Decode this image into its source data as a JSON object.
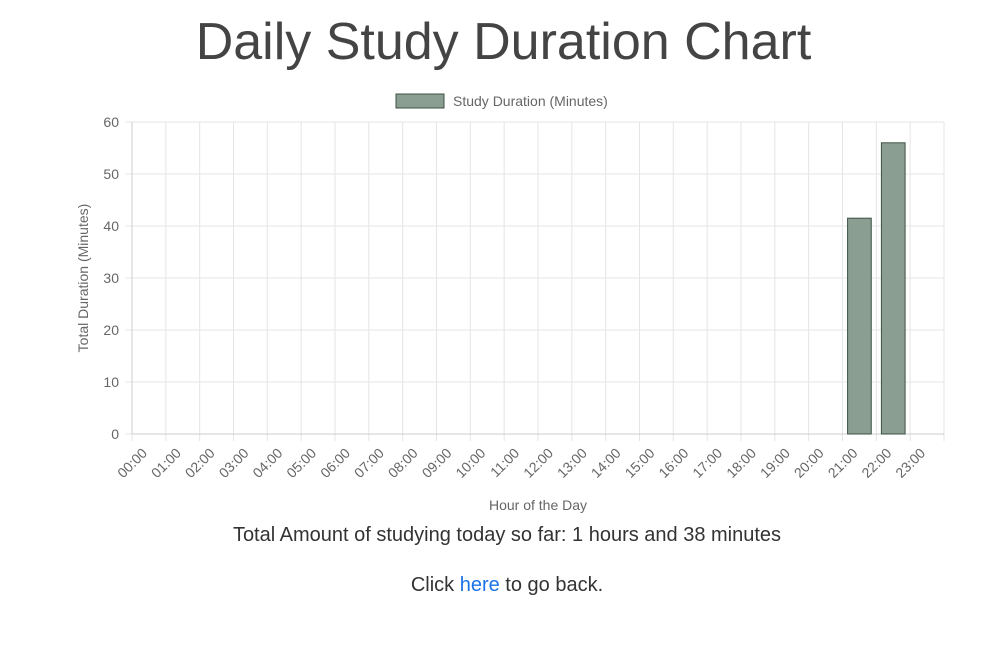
{
  "page": {
    "title": "Daily Study Duration Chart",
    "summary": "Total Amount of studying today so far: 1 hours and 38 minutes",
    "back_prefix": "Click ",
    "back_link": "here",
    "back_suffix": " to go back."
  },
  "colors": {
    "bar_fill": "#8a9e91",
    "bar_border": "#3d5244",
    "grid": "#e5e5e5",
    "axis": "#cccccc",
    "tick_text": "#666666"
  },
  "chart_data": {
    "type": "bar",
    "xlabel": "Hour of the Day",
    "ylabel": "Total Duration (Minutes)",
    "ylim": [
      0,
      60
    ],
    "yticks": [
      0,
      10,
      20,
      30,
      40,
      50,
      60
    ],
    "grid": true,
    "legend_position": "top-center",
    "categories": [
      "00:00",
      "01:00",
      "02:00",
      "03:00",
      "04:00",
      "05:00",
      "06:00",
      "07:00",
      "08:00",
      "09:00",
      "10:00",
      "11:00",
      "12:00",
      "13:00",
      "14:00",
      "15:00",
      "16:00",
      "17:00",
      "18:00",
      "19:00",
      "20:00",
      "21:00",
      "22:00",
      "23:00"
    ],
    "series": [
      {
        "name": "Study Duration (Minutes)",
        "values": [
          0,
          0,
          0,
          0,
          0,
          0,
          0,
          0,
          0,
          0,
          0,
          0,
          0,
          0,
          0,
          0,
          0,
          0,
          0,
          0,
          0,
          41.5,
          56,
          0
        ]
      }
    ]
  }
}
